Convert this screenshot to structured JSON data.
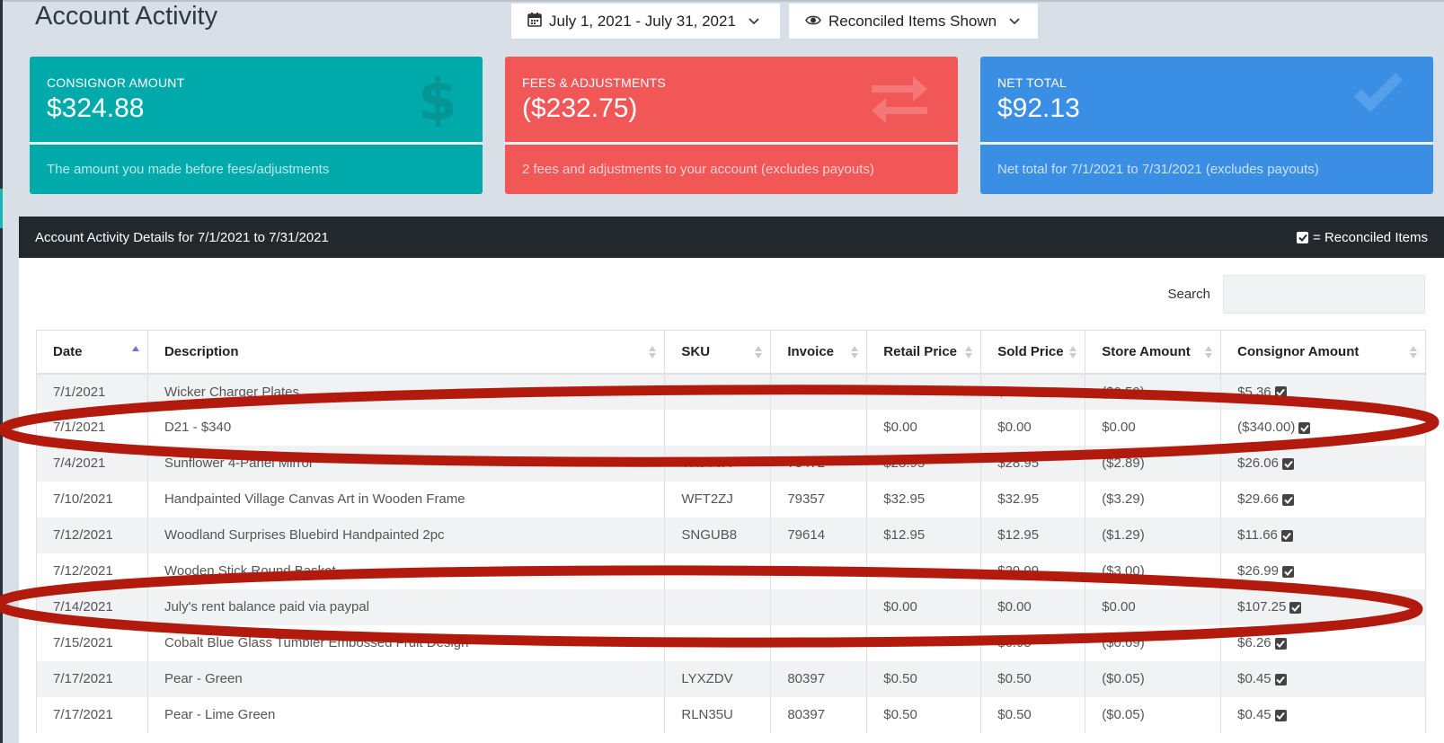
{
  "page_title": "Account Activity",
  "filters": {
    "date_range": "July 1, 2021 - July 31, 2021",
    "reconciled": "Reconciled Items Shown"
  },
  "cards": {
    "consignor": {
      "label": "CONSIGNOR AMOUNT",
      "value": "$324.88",
      "footer": "The amount you made before fees/adjustments",
      "color": "#00aaaa",
      "icon": "dollar-icon"
    },
    "fees": {
      "label": "FEES & ADJUSTMENTS",
      "value": "($232.75)",
      "footer": "2 fees and adjustments to your account (excludes payouts)",
      "color": "#f25757",
      "icon": "exchange-icon"
    },
    "net": {
      "label": "NET TOTAL",
      "value": "$92.13",
      "footer": "Net total for 7/1/2021 to 7/31/2021 (excludes payouts)",
      "color": "#3a8ee4",
      "icon": "checkmark-icon"
    }
  },
  "panel": {
    "title": "Account Activity Details for 7/1/2021 to 7/31/2021",
    "legend": "= Reconciled Items",
    "search_label": "Search"
  },
  "table": {
    "columns": [
      "Date",
      "Description",
      "SKU",
      "Invoice",
      "Retail Price",
      "Sold Price",
      "Store Amount",
      "Consignor Amount"
    ],
    "rows": [
      [
        "7/1/2021",
        "Wicker Charger Plates",
        "",
        "",
        "",
        "$5.95",
        "($0.59)",
        "$5.36"
      ],
      [
        "7/1/2021",
        "D21 - $340",
        "",
        "",
        "$0.00",
        "$0.00",
        "$0.00",
        "($340.00)"
      ],
      [
        "7/4/2021",
        "Sunflower 4-Panel Mirror",
        "TRJTVA",
        "78472",
        "$28.95",
        "$28.95",
        "($2.89)",
        "$26.06"
      ],
      [
        "7/10/2021",
        "Handpainted Village Canvas Art in Wooden Frame",
        "WFT2ZJ",
        "79357",
        "$32.95",
        "$32.95",
        "($3.29)",
        "$29.66"
      ],
      [
        "7/12/2021",
        "Woodland Surprises Bluebird Handpainted 2pc",
        "SNGUB8",
        "79614",
        "$12.95",
        "$12.95",
        "($1.29)",
        "$11.66"
      ],
      [
        "7/12/2021",
        "Wooden Stick Round Basket",
        "",
        "",
        "",
        "$29.99",
        "($3.00)",
        "$26.99"
      ],
      [
        "7/14/2021",
        "July's rent balance paid via paypal",
        "",
        "",
        "$0.00",
        "$0.00",
        "$0.00",
        "$107.25"
      ],
      [
        "7/15/2021",
        "Cobalt Blue Glass Tumbler Embossed Fruit Design",
        "",
        "",
        "",
        "$6.95",
        "($0.69)",
        "$6.26"
      ],
      [
        "7/17/2021",
        "Pear - Green",
        "LYXZDV",
        "80397",
        "$0.50",
        "$0.50",
        "($0.05)",
        "$0.45"
      ],
      [
        "7/17/2021",
        "Pear - Lime Green",
        "RLN35U",
        "80397",
        "$0.50",
        "$0.50",
        "($0.05)",
        "$0.45"
      ]
    ]
  },
  "annotation_color": "#b31a0e"
}
